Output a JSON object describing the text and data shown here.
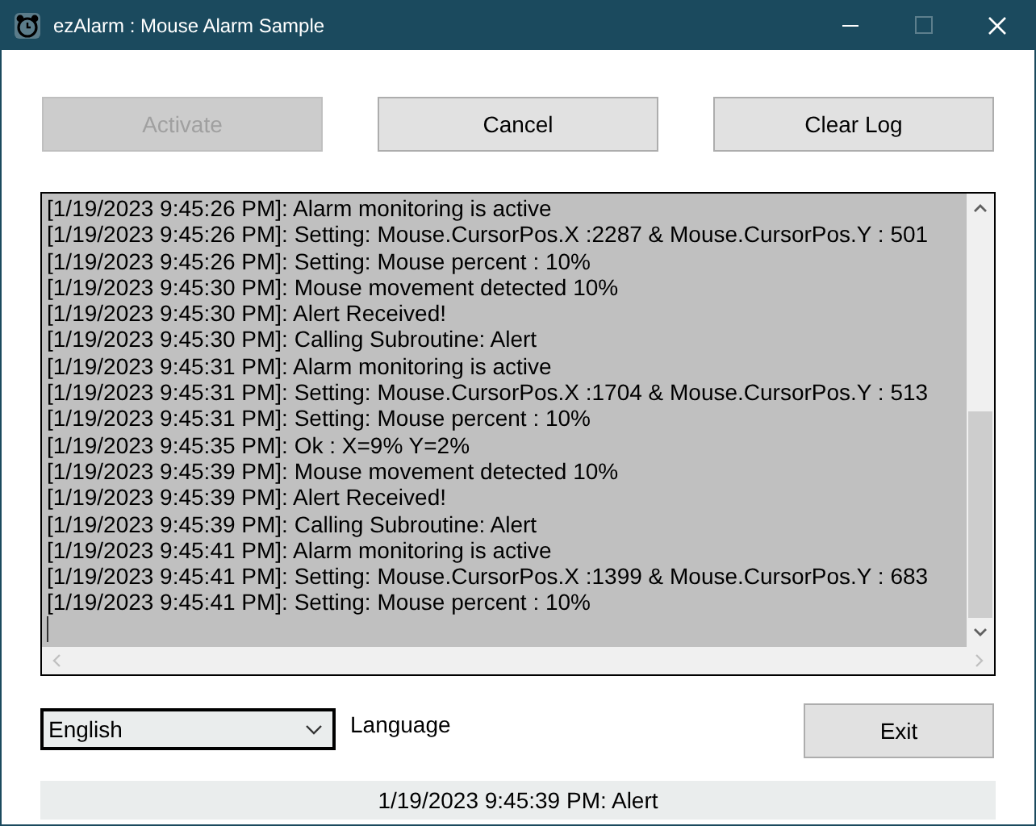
{
  "window": {
    "title": "ezAlarm : Mouse Alarm Sample"
  },
  "buttons": [
    {
      "label": "Activate",
      "disabled": true
    },
    {
      "label": "Cancel",
      "disabled": false
    },
    {
      "label": "Clear Log",
      "disabled": false
    }
  ],
  "log": [
    "[1/19/2023 9:45:26 PM]: Alarm monitoring is active",
    "[1/19/2023 9:45:26 PM]: Setting: Mouse.CursorPos.X :2287 & Mouse.CursorPos.Y : 501",
    "[1/19/2023 9:45:26 PM]: Setting: Mouse percent : 10%",
    "[1/19/2023 9:45:30 PM]: Mouse movement detected 10%",
    "[1/19/2023 9:45:30 PM]: Alert Received!",
    "[1/19/2023 9:45:30 PM]: Calling Subroutine: Alert",
    "[1/19/2023 9:45:31 PM]: Alarm monitoring is active",
    "[1/19/2023 9:45:31 PM]: Setting: Mouse.CursorPos.X :1704 & Mouse.CursorPos.Y : 513",
    "[1/19/2023 9:45:31 PM]: Setting: Mouse percent : 10%",
    "[1/19/2023 9:45:35 PM]: Ok : X=9% Y=2%",
    "[1/19/2023 9:45:39 PM]: Mouse movement detected 10%",
    "[1/19/2023 9:45:39 PM]: Alert Received!",
    "[1/19/2023 9:45:39 PM]: Calling Subroutine: Alert",
    "[1/19/2023 9:45:41 PM]: Alarm monitoring is active",
    "[1/19/2023 9:45:41 PM]: Setting: Mouse.CursorPos.X :1399 & Mouse.CursorPos.Y : 683",
    "[1/19/2023 9:45:41 PM]: Setting: Mouse percent : 10%"
  ],
  "language": {
    "value": "English",
    "label": "Language"
  },
  "exit_button": "Exit",
  "status_bar": "1/19/2023 9:45:39 PM: Alert"
}
